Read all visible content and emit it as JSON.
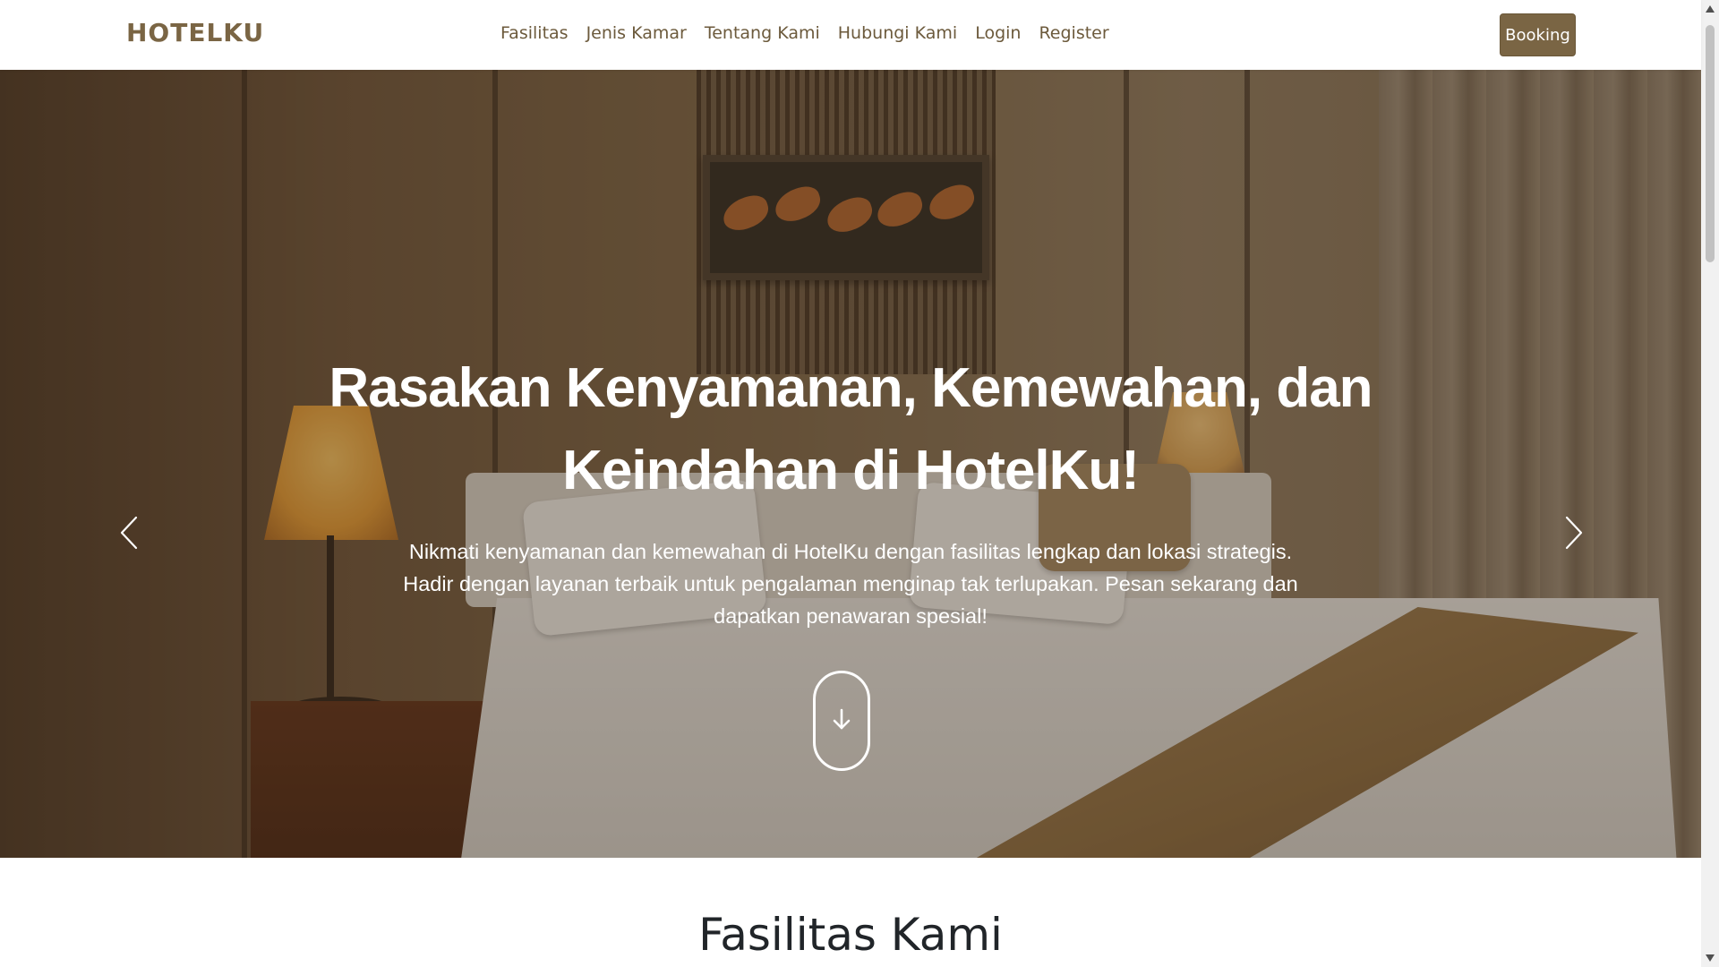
{
  "navbar": {
    "brand": "HOTELKU",
    "links": [
      "Fasilitas",
      "Jenis Kamar",
      "Tentang Kami",
      "Hubungi Kami",
      "Login",
      "Register"
    ],
    "booking_label": "Booking"
  },
  "hero": {
    "title_line1": "Rasakan Kenyamanan, Kemewahan, dan",
    "title_line2": "Keindahan di HotelKu!",
    "description_line1": "Nikmati kenyamanan dan kemewahan di HotelKu dengan fasilitas lengkap dan lokasi strategis.",
    "description_line2": "Hadir dengan layanan terbaik untuk pengalaman menginap tak terlupakan. Pesan sekarang dan",
    "description_line3": "dapatkan penawaran spesial!",
    "scroll_icon": "arrow-down-icon",
    "prev_icon": "chevron-left-icon",
    "next_icon": "chevron-right-icon"
  },
  "section": {
    "title": "Fasilitas Kami"
  },
  "colors": {
    "brand": "#7a6544",
    "nav_text": "#6c5a3c",
    "booking_bg": "#7a6544"
  }
}
